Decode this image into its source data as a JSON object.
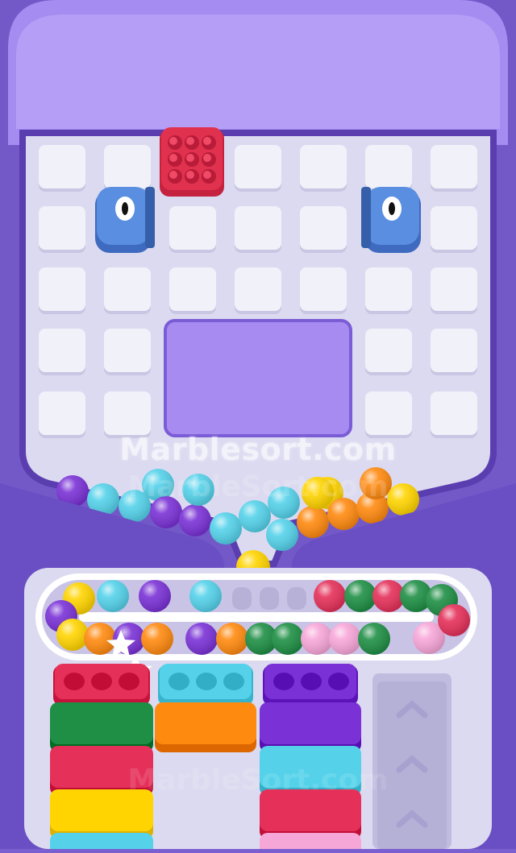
{
  "game": {
    "watermark": "Marblesort.com",
    "watermark_ghost": "MarbleSort.com",
    "watermark_bottom": "MarbleSort.com"
  },
  "board": {
    "grid_rows": 5,
    "grid_columns": 7,
    "locked_piece": {
      "color": "#e0314f",
      "bead_count": 9
    },
    "launchers": [
      {
        "side": "left",
        "color": "#4e7fd2"
      },
      {
        "side": "right",
        "color": "#4e7fd2"
      }
    ]
  },
  "hopper": {
    "marbles": [
      "purple",
      "cyan",
      "cyan",
      "cyan",
      "purple",
      "purple",
      "cyan",
      "cyan",
      "cyan",
      "cyan",
      "yellow",
      "cyan",
      "orange",
      "yellow",
      "orange",
      "orange",
      "orange",
      "yellow",
      "yellow"
    ]
  },
  "conveyor": {
    "top_lane": [
      "yellow",
      "cyan",
      "purple",
      "cyan",
      "empty",
      "empty",
      "empty",
      "empty",
      "red",
      "green",
      "red",
      "green",
      "green"
    ],
    "bottom_lane": [
      "purple",
      "yellow",
      "orange",
      "purple",
      "orange",
      "purple",
      "orange",
      "green",
      "green",
      "pink",
      "pink",
      "green",
      "pink",
      "red"
    ]
  },
  "sorters": [
    {
      "column": 1,
      "slots": [
        "red",
        "red",
        "red"
      ],
      "stack": [
        "green",
        "red",
        "yellow",
        "cyan"
      ]
    },
    {
      "column": 2,
      "slots": [
        "cyan",
        "cyan",
        "cyan"
      ],
      "stack": [
        "orange"
      ]
    },
    {
      "column": 3,
      "slots": [
        "purple",
        "purple",
        "purple"
      ],
      "stack": [
        "purple",
        "cyan",
        "red",
        "pink"
      ]
    },
    {
      "column": 4,
      "slots": [],
      "stack": [],
      "state": "empty"
    }
  ],
  "colors": {
    "purple": "#7a32d6",
    "cyan": "#55d2ea",
    "yellow": "#ffd400",
    "orange": "#ff8a10",
    "red": "#e5315a",
    "green": "#1f8f45",
    "pink": "#f7a6d8",
    "frame": "#a58cf0",
    "frame_dark": "#5a3eb0",
    "board": "#dcdaf0",
    "tile": "#f1f1fa"
  }
}
